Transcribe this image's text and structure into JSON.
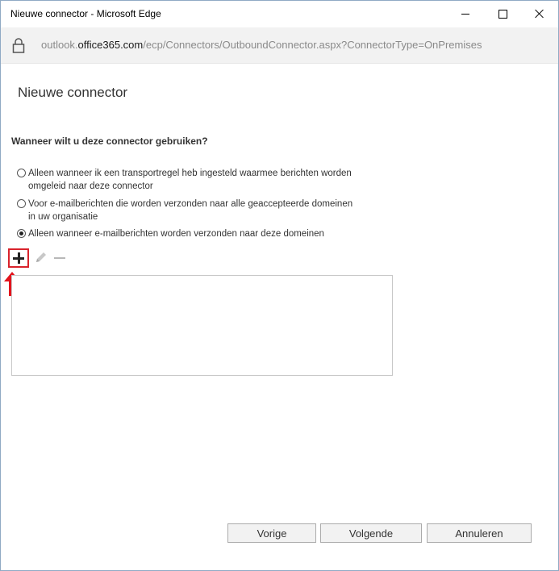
{
  "window": {
    "title": "Nieuwe connector - Microsoft Edge"
  },
  "address": {
    "prefix": "outlook.",
    "domain": "office365.com",
    "path": "/ecp/Connectors/OutboundConnector.aspx?ConnectorType=OnPremises"
  },
  "page": {
    "title": "Nieuwe connector",
    "question": "Wanneer wilt u deze connector gebruiken?",
    "options": [
      {
        "label": "Alleen wanneer ik een transportregel heb ingesteld waarmee berichten worden omgeleid naar deze connector",
        "checked": false
      },
      {
        "label": "Voor e-mailberichten die worden verzonden naar alle geaccepteerde domeinen in uw organisatie",
        "checked": false
      },
      {
        "label": "Alleen wanneer e-mailberichten worden verzonden naar deze domeinen",
        "checked": true
      }
    ],
    "toolbar_icons": [
      "add-icon",
      "edit-icon",
      "remove-icon"
    ],
    "domains": []
  },
  "buttons": {
    "previous": "Vorige",
    "next": "Volgende",
    "cancel": "Annuleren"
  },
  "colors": {
    "highlight": "#d9232c",
    "titlebar": "#ffffff",
    "addressbar": "#f2f2f2"
  }
}
